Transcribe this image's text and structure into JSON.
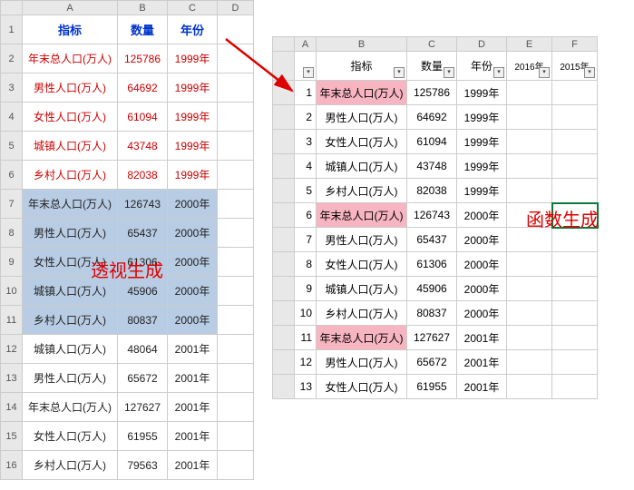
{
  "left": {
    "cols": [
      "A",
      "B",
      "C",
      "D"
    ],
    "headers": {
      "A": "指标",
      "B": "数量",
      "C": "年份"
    },
    "rows": [
      {
        "n": "2",
        "a": "年末总人口(万人)",
        "b": "125786",
        "c": "1999年",
        "cls": "red-text"
      },
      {
        "n": "3",
        "a": "男性人口(万人)",
        "b": "64692",
        "c": "1999年",
        "cls": "red-text"
      },
      {
        "n": "4",
        "a": "女性人口(万人)",
        "b": "61094",
        "c": "1999年",
        "cls": "red-text"
      },
      {
        "n": "5",
        "a": "城镇人口(万人)",
        "b": "43748",
        "c": "1999年",
        "cls": "red-text"
      },
      {
        "n": "6",
        "a": "乡村人口(万人)",
        "b": "82038",
        "c": "1999年",
        "cls": "red-text"
      },
      {
        "n": "7",
        "a": "年末总人口(万人)",
        "b": "126743",
        "c": "2000年",
        "cls": "black-text",
        "sel": true
      },
      {
        "n": "8",
        "a": "男性人口(万人)",
        "b": "65437",
        "c": "2000年",
        "cls": "black-text",
        "sel": true
      },
      {
        "n": "9",
        "a": "女性人口(万人)",
        "b": "61306",
        "c": "2000年",
        "cls": "black-text",
        "sel": true
      },
      {
        "n": "10",
        "a": "城镇人口(万人)",
        "b": "45906",
        "c": "2000年",
        "cls": "black-text",
        "sel": true
      },
      {
        "n": "11",
        "a": "乡村人口(万人)",
        "b": "80837",
        "c": "2000年",
        "cls": "black-text",
        "sel": true
      },
      {
        "n": "12",
        "a": "城镇人口(万人)",
        "b": "48064",
        "c": "2001年",
        "cls": "black-text"
      },
      {
        "n": "13",
        "a": "男性人口(万人)",
        "b": "65672",
        "c": "2001年",
        "cls": "black-text"
      },
      {
        "n": "14",
        "a": "年末总人口(万人)",
        "b": "127627",
        "c": "2001年",
        "cls": "black-text"
      },
      {
        "n": "15",
        "a": "女性人口(万人)",
        "b": "61955",
        "c": "2001年",
        "cls": "black-text"
      },
      {
        "n": "16",
        "a": "乡村人口(万人)",
        "b": "79563",
        "c": "2001年",
        "cls": "black-text"
      }
    ]
  },
  "right": {
    "cols": [
      "A",
      "B",
      "C",
      "D",
      "E",
      "F"
    ],
    "headers": {
      "B": "指标",
      "C": "数量",
      "D": "年份",
      "E": "2016年",
      "F": "2015年"
    },
    "rows": [
      {
        "n": "1",
        "b": "年末总人口(万人)",
        "c": "125786",
        "d": "1999年",
        "hl": true
      },
      {
        "n": "2",
        "b": "男性人口(万人)",
        "c": "64692",
        "d": "1999年"
      },
      {
        "n": "3",
        "b": "女性人口(万人)",
        "c": "61094",
        "d": "1999年"
      },
      {
        "n": "4",
        "b": "城镇人口(万人)",
        "c": "43748",
        "d": "1999年"
      },
      {
        "n": "5",
        "b": "乡村人口(万人)",
        "c": "82038",
        "d": "1999年"
      },
      {
        "n": "6",
        "b": "年末总人口(万人)",
        "c": "126743",
        "d": "2000年",
        "hl": true
      },
      {
        "n": "7",
        "b": "男性人口(万人)",
        "c": "65437",
        "d": "2000年"
      },
      {
        "n": "8",
        "b": "女性人口(万人)",
        "c": "61306",
        "d": "2000年"
      },
      {
        "n": "9",
        "b": "城镇人口(万人)",
        "c": "45906",
        "d": "2000年"
      },
      {
        "n": "10",
        "b": "乡村人口(万人)",
        "c": "80837",
        "d": "2000年"
      },
      {
        "n": "11",
        "b": "年末总人口(万人)",
        "c": "127627",
        "d": "2001年",
        "hl": true
      },
      {
        "n": "12",
        "b": "男性人口(万人)",
        "c": "65672",
        "d": "2001年"
      },
      {
        "n": "13",
        "b": "女性人口(万人)",
        "c": "61955",
        "d": "2001年"
      }
    ]
  },
  "overlays": {
    "pivot": "透视生成",
    "formula": "函数生成"
  }
}
